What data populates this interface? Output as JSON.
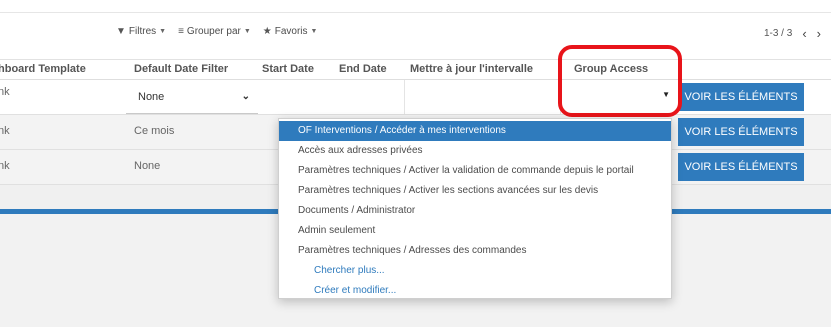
{
  "control_panel": {
    "filters_label": "Filtres",
    "group_by_label": "Grouper par",
    "favorites_label": "Favoris",
    "pager": "1-3 / 3"
  },
  "columns": {
    "dashboard_template": "hboard Template",
    "default_date_filter": "Default Date Filter",
    "start_date": "Start Date",
    "end_date": "End Date",
    "update_interval": "Mettre à jour l'intervalle",
    "group_access": "Group Access"
  },
  "rows": [
    {
      "template": "nk",
      "date_filter": "None",
      "button": "VOIR LES ÉLÉMENTS"
    },
    {
      "template": "nk",
      "date_filter": "Ce mois",
      "button": "VOIR LES ÉLÉMENTS"
    },
    {
      "template": "nk",
      "date_filter": "None",
      "button": "VOIR LES ÉLÉMENTS"
    }
  ],
  "dropdown": {
    "options": [
      "OF Interventions / Accéder à mes interventions",
      "Accès aux adresses privées",
      "Paramètres techniques / Activer la validation de commande depuis le portail",
      "Paramètres techniques / Activer les sections avancées sur les devis",
      "Documents / Administrator",
      "Admin seulement",
      "Paramètres techniques / Adresses des commandes"
    ],
    "search_more": "Chercher plus...",
    "create_edit": "Créer et modifier..."
  },
  "colors": {
    "primary": "#2f7bbd",
    "highlight_ring": "#e8141a"
  }
}
